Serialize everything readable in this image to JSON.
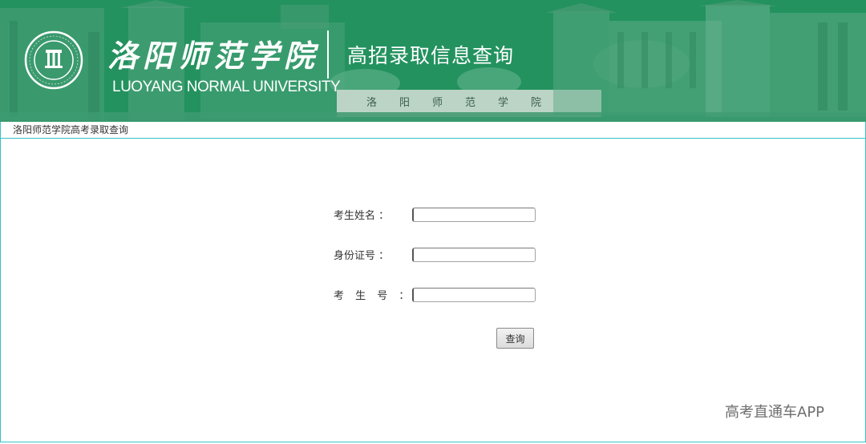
{
  "header": {
    "school_name_cn": "洛阳师范学院",
    "school_name_en": "LUOYANG NORMAL UNIVERSITY",
    "system_title": "高招录取信息查询",
    "gate_inscription": "洛阳师范学院",
    "logo": {
      "icon": "university-seal-icon"
    }
  },
  "breadcrumb": {
    "text": "洛阳师范学院高考录取查询"
  },
  "form": {
    "name_label": "考生姓名 ：",
    "name_value": "",
    "id_label": "身份证号 ：",
    "id_value": "",
    "exam_label": "考 生 号 ：",
    "exam_value": "",
    "query_button": "查询"
  },
  "watermark": {
    "text": "高考直通车APP"
  },
  "colors": {
    "banner_green": "#2a9a6c",
    "panel_border": "#37c1c3",
    "text": "#333333"
  }
}
